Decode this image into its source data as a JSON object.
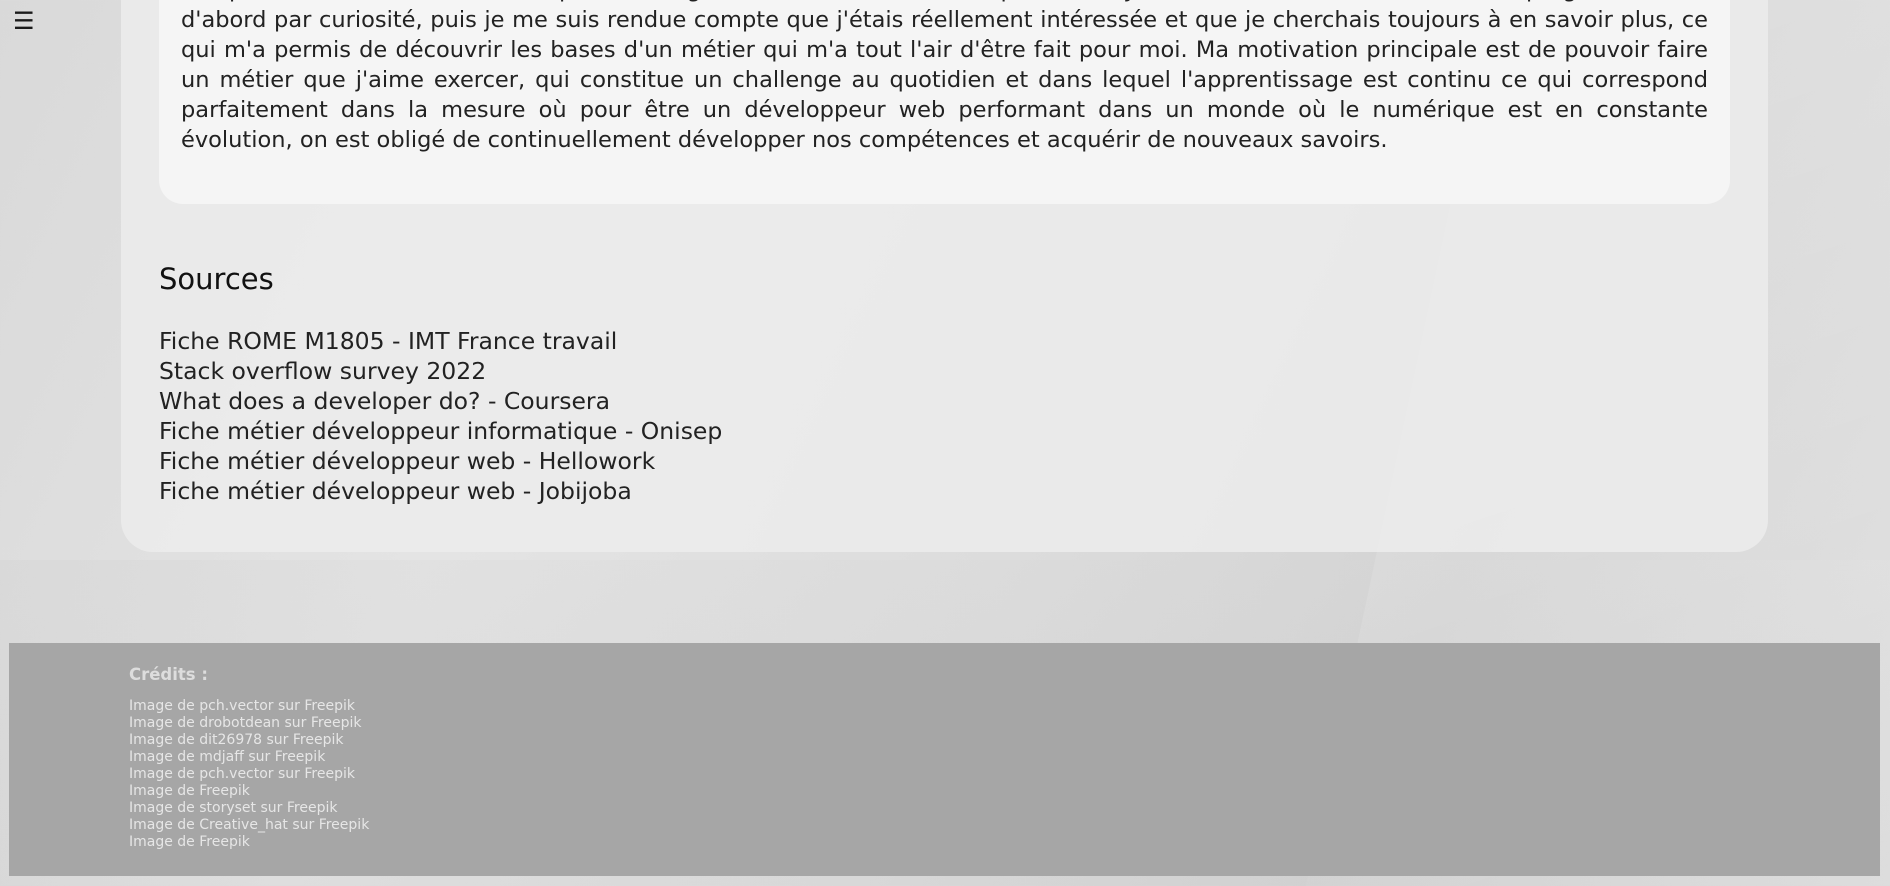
{
  "menu": {
    "icon": "hamburger-menu-icon",
    "glyph": "☰"
  },
  "article": {
    "paragraph": "composants d'un ordinateur, lesquels interagissent entre eux et dans quel ordre. Je me suis ensuite intéressée à la programmation, d'abord par curiosité, puis je me suis rendue compte que j'étais réellement intéressée et que je cherchais toujours à en savoir plus, ce qui m'a permis de découvrir les bases d'un métier qui m'a tout l'air d'être fait pour moi. Ma motivation principale est de pouvoir faire un métier que j'aime exercer, qui constitue un challenge au quotidien et dans lequel l'apprentissage est continu ce qui correspond parfaitement dans la mesure où pour être un développeur web performant dans un monde où le numérique est en constante évolution, on est obligé de continuellement développer nos compétences et acquérir de nouveaux savoirs."
  },
  "sources": {
    "title": "Sources",
    "items": [
      {
        "label": "Fiche ROME M1805 - IMT France travail"
      },
      {
        "label": "Stack overflow survey 2022"
      },
      {
        "label": "What does a developer do? - Coursera"
      },
      {
        "label": "Fiche métier développeur informatique - Onisep"
      },
      {
        "label": "Fiche métier développeur web - Hellowork"
      },
      {
        "label": "Fiche métier développeur web - Jobijoba"
      }
    ]
  },
  "footer": {
    "title": "Crédits :",
    "credits": [
      {
        "label": "Image de pch.vector sur Freepik"
      },
      {
        "label": "Image de drobotdean sur Freepik"
      },
      {
        "label": "Image de dit26978 sur Freepik"
      },
      {
        "label": "Image de mdjaff sur Freepik"
      },
      {
        "label": "Image de pch.vector sur Freepik"
      },
      {
        "label": "Image de Freepik"
      },
      {
        "label": "Image de storyset sur Freepik"
      },
      {
        "label": "Image de Creative_hat sur Freepik"
      },
      {
        "label": "Image de Freepik"
      }
    ]
  },
  "colors": {
    "footer_bg": "#a6a6a6",
    "card_bg": "#ececec",
    "text_card_bg": "#f5f5f5"
  }
}
